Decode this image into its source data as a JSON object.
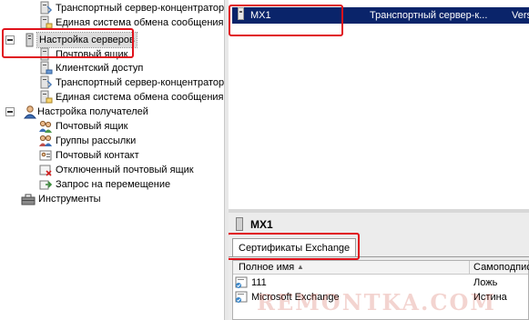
{
  "tree": {
    "items": [
      {
        "label": "Транспортный сервер-концентратор",
        "icon": "server-icon"
      },
      {
        "label": "Единая система обмена сообщениями",
        "icon": "server-icon"
      },
      {
        "label": "Настройка серверов",
        "icon": "server-group-icon"
      },
      {
        "label": "Почтовый ящик",
        "icon": "server-icon"
      },
      {
        "label": "Клиентский доступ",
        "icon": "server-icon"
      },
      {
        "label": "Транспортный сервер-концентратор",
        "icon": "server-icon"
      },
      {
        "label": "Единая система обмена сообщениями",
        "icon": "server-icon"
      },
      {
        "label": "Настройка получателей",
        "icon": "user-icon"
      },
      {
        "label": "Почтовый ящик",
        "icon": "users-icon"
      },
      {
        "label": "Группы рассылки",
        "icon": "group-icon"
      },
      {
        "label": "Почтовый контакт",
        "icon": "contact-icon"
      },
      {
        "label": "Отключенный почтовый ящик",
        "icon": "disconnected-mailbox-icon"
      },
      {
        "label": "Запрос на перемещение",
        "icon": "move-request-icon"
      },
      {
        "label": "Инструменты",
        "icon": "toolbox-icon"
      }
    ]
  },
  "results": {
    "selected_row": {
      "name": "MX1",
      "role": "Транспортный сервер-к...",
      "version": "Versi"
    }
  },
  "detail": {
    "title": "MX1",
    "tab_label": "Сертификаты Exchange",
    "columns": [
      "Полное имя",
      "Самоподпис"
    ],
    "rows": [
      {
        "name": "111",
        "selfsigned": "Ложь"
      },
      {
        "name": "Microsoft Exchange",
        "selfsigned": "Истина"
      }
    ]
  },
  "watermark": "REMONTKA.COM",
  "colors": {
    "selection": "#0a246a",
    "highlight_box": "#e0121b"
  }
}
